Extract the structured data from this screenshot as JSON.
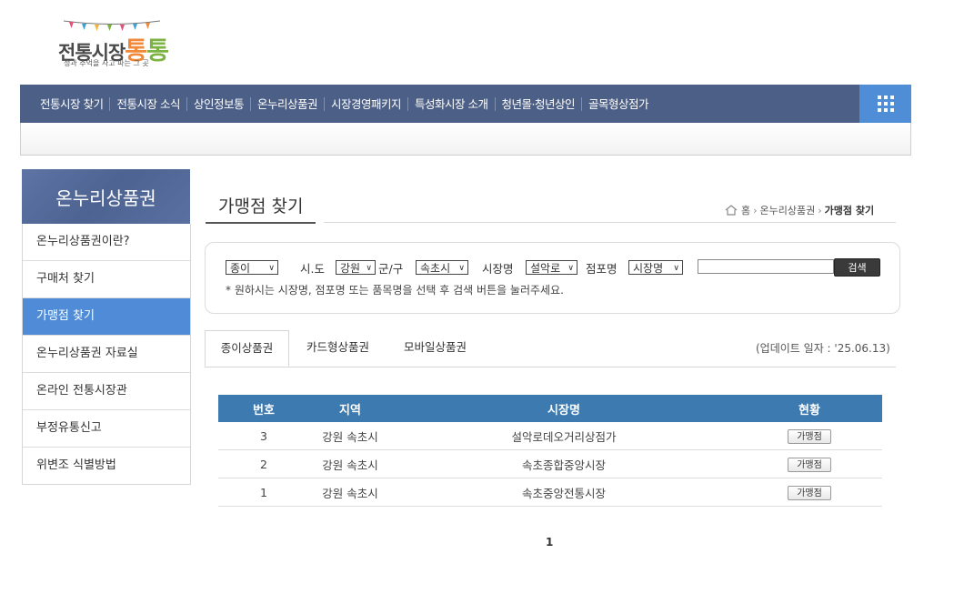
{
  "logo": {
    "title_part1": "전통시장",
    "title_part2": "통",
    "title_part3": "통",
    "tagline": "정과 추억을 사고 파는 그 곳"
  },
  "nav": {
    "items": [
      "전통시장 찾기",
      "전통시장 소식",
      "상인정보통",
      "온누리상품권",
      "시장경영패키지",
      "특성화시장 소개",
      "청년몰·청년상인",
      "골목형상점가"
    ],
    "all_menu_icon": "grid-icon"
  },
  "sidebar": {
    "title": "온누리상품권",
    "items": [
      {
        "label": "온누리상품권이란?"
      },
      {
        "label": "구매처 찾기"
      },
      {
        "label": "가맹점 찾기"
      },
      {
        "label": "온누리상품권 자료실"
      },
      {
        "label": "온라인 전통시장관"
      },
      {
        "label": "부정유통신고"
      },
      {
        "label": "위변조 식별방법"
      }
    ],
    "active_index": 2
  },
  "page": {
    "title": "가맹점 찾기",
    "breadcrumb": {
      "home": "홈",
      "parent": "온누리상품권",
      "current": "가맹점 찾기"
    }
  },
  "search": {
    "type_select": "종이",
    "sido_label": "시.도",
    "sido_select": "강원",
    "gungu_label": "군/구",
    "gungu_select": "속초시",
    "market_label": "시장명",
    "market_select": "설악로",
    "store_label": "점포명",
    "store_select": "시장명",
    "keyword_value": "",
    "button": "검색",
    "hint": "* 원하시는 시장명, 점포명 또는 품목명을 선택 후 검색 버튼을 눌러주세요."
  },
  "tabs": {
    "items": [
      "종이상품권",
      "카드형상품권",
      "모바일상품권"
    ],
    "active_index": 0,
    "update_date": "(업데이트 일자 : '25.06.13)"
  },
  "table": {
    "headers": [
      "번호",
      "지역",
      "시장명",
      "현황"
    ],
    "rows": [
      {
        "no": "3",
        "region": "강원 속초시",
        "market": "설악로데오거리상점가",
        "status": "가맹점"
      },
      {
        "no": "2",
        "region": "강원 속초시",
        "market": "속초종합중앙시장",
        "status": "가맹점"
      },
      {
        "no": "1",
        "region": "강원 속초시",
        "market": "속초중앙전통시장",
        "status": "가맹점"
      }
    ]
  },
  "pagination": {
    "current": "1"
  },
  "colors": {
    "nav_bg": "#4c5f86",
    "accent_blue": "#4f8bd6",
    "table_header": "#3d7ab0",
    "logo_orange": "#f2893a",
    "logo_green": "#7cb342"
  }
}
